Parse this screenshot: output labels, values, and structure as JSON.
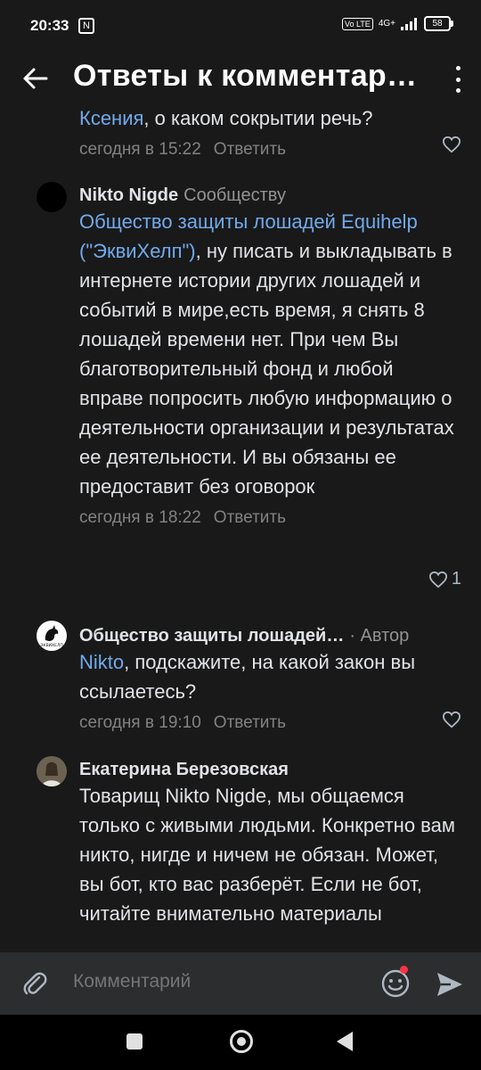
{
  "status": {
    "time": "20:33",
    "nfc": "N",
    "volte": "Vo LTE",
    "network": "4G+",
    "battery": "58"
  },
  "header": {
    "title": "Ответы к комментарию"
  },
  "comments": [
    {
      "mention": "Ксения",
      "text": ", о каком сокрытии речь?",
      "time": "сегодня в 15:22",
      "reply": "Ответить",
      "likes": ""
    },
    {
      "author": "Nikto Nigde",
      "role": "Сообществу",
      "mention": "Общество защиты лошадей Equihelp (\"ЭквиХелп\")",
      "text": ", ну писать и выкладывать в интернете истории других лошадей и событий в мире,есть время, я снять 8 лошадей времени нет. При чем Вы благотворительный фонд и любой вправе попросить любую информацию о деятельности организации и результатах ее деятельности. И вы обязаны ее предоставит без оговорок",
      "time": "сегодня в 18:22",
      "reply": "Ответить",
      "likes": "1"
    },
    {
      "author": "Общество защиты лошадей…",
      "role": "· Автор",
      "mention": "Nikto",
      "text": ", подскажите, на какой закон вы ссылаетесь?",
      "time": "сегодня в 19:10",
      "reply": "Ответить",
      "likes": "",
      "avatar_text": "ЭКВИХЕЛП"
    },
    {
      "author": "Екатерина Березовская",
      "text": "Товарищ Nikto Nigde, мы общаемся только с живыми людьми. Конкретно вам никто, нигде и ничем не обязан. Может, вы бот, кто вас разберёт. Если не бот, читайте внимательно материалы"
    }
  ],
  "input": {
    "placeholder": "Комментарий"
  },
  "colors": {
    "background": "#19191a",
    "mention": "#71aaeb",
    "input_bar": "#2c2d2e",
    "badge": "#ff3347"
  }
}
